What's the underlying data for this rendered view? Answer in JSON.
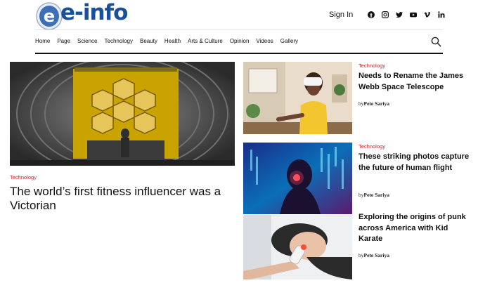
{
  "header": {
    "logo_text": "e-info",
    "sign_in": "Sign In",
    "social": [
      "facebook-icon",
      "instagram-icon",
      "twitter-icon",
      "youtube-icon",
      "vimeo-icon",
      "linkedin-icon"
    ]
  },
  "nav": {
    "items": [
      "Home",
      "Page",
      "Science",
      "Technology",
      "Beauty",
      "Health",
      "Arts & Culture",
      "Opinion",
      "Videos",
      "Gallery"
    ]
  },
  "main": {
    "category": "Technology",
    "title": "The world’s first fitness influencer was a Victorian"
  },
  "posts": [
    {
      "category": "Technology",
      "title": "Needs to Rename the James Webb Space Telescope",
      "by": "by",
      "author": "Pete Sariya"
    },
    {
      "category": "Technology",
      "title": "These striking photos capture the future of human flight",
      "by": "by",
      "author": "Pete Sariya"
    },
    {
      "category": "",
      "title": "Exploring the origins of punk across America with Kid Karate",
      "by": "by",
      "author": "Pete Sariya"
    }
  ],
  "colors": {
    "accent": "#c0262b",
    "logo": "#1a4f9a"
  }
}
